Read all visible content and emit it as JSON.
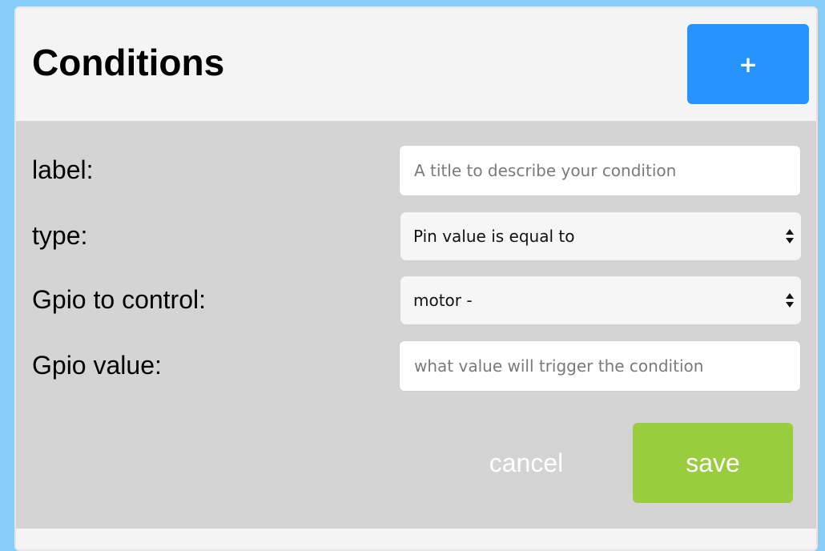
{
  "header": {
    "title": "Conditions",
    "add_label": "+",
    "add_icon": "plus-icon"
  },
  "form": {
    "label": {
      "label": "label:",
      "value": "",
      "placeholder": "A title to describe your condition"
    },
    "type": {
      "label": "type:",
      "selected": "Pin value is equal to",
      "icon": "select-arrows-icon"
    },
    "gpio_control": {
      "label": "Gpio to control:",
      "selected": "motor -",
      "icon": "select-arrows-icon"
    },
    "gpio_value": {
      "label": "Gpio value:",
      "value": "",
      "placeholder": "what value will trigger the condition"
    }
  },
  "actions": {
    "cancel_label": "cancel",
    "save_label": "save"
  },
  "colors": {
    "page_background": "#87cefa",
    "add_button": "#2793fd",
    "save_button": "#9acd3e",
    "form_panel": "#d4d4d4",
    "header_background": "#f4f4f4"
  }
}
